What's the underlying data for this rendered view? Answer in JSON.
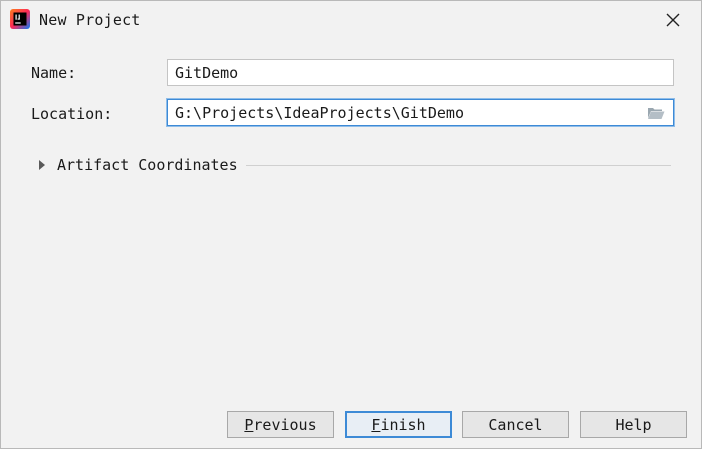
{
  "window": {
    "title": "New Project"
  },
  "form": {
    "name_label": "Name:",
    "name_value": "GitDemo",
    "location_label": "Location:",
    "location_value": "G:\\Projects\\IdeaProjects\\GitDemo"
  },
  "artifact": {
    "label": "Artifact Coordinates",
    "expanded": false
  },
  "buttons": {
    "previous_mnemonic": "P",
    "previous_rest": "revious",
    "finish_mnemonic": "F",
    "finish_rest": "inish",
    "cancel": "Cancel",
    "help": "Help"
  },
  "icons": {
    "app": "intellij-idea-icon",
    "close": "close-icon",
    "browse": "folder-icon",
    "expand": "expand-triangle-icon"
  },
  "colors": {
    "background": "#f2f2f2",
    "focus_accent": "#3d8ad6"
  }
}
